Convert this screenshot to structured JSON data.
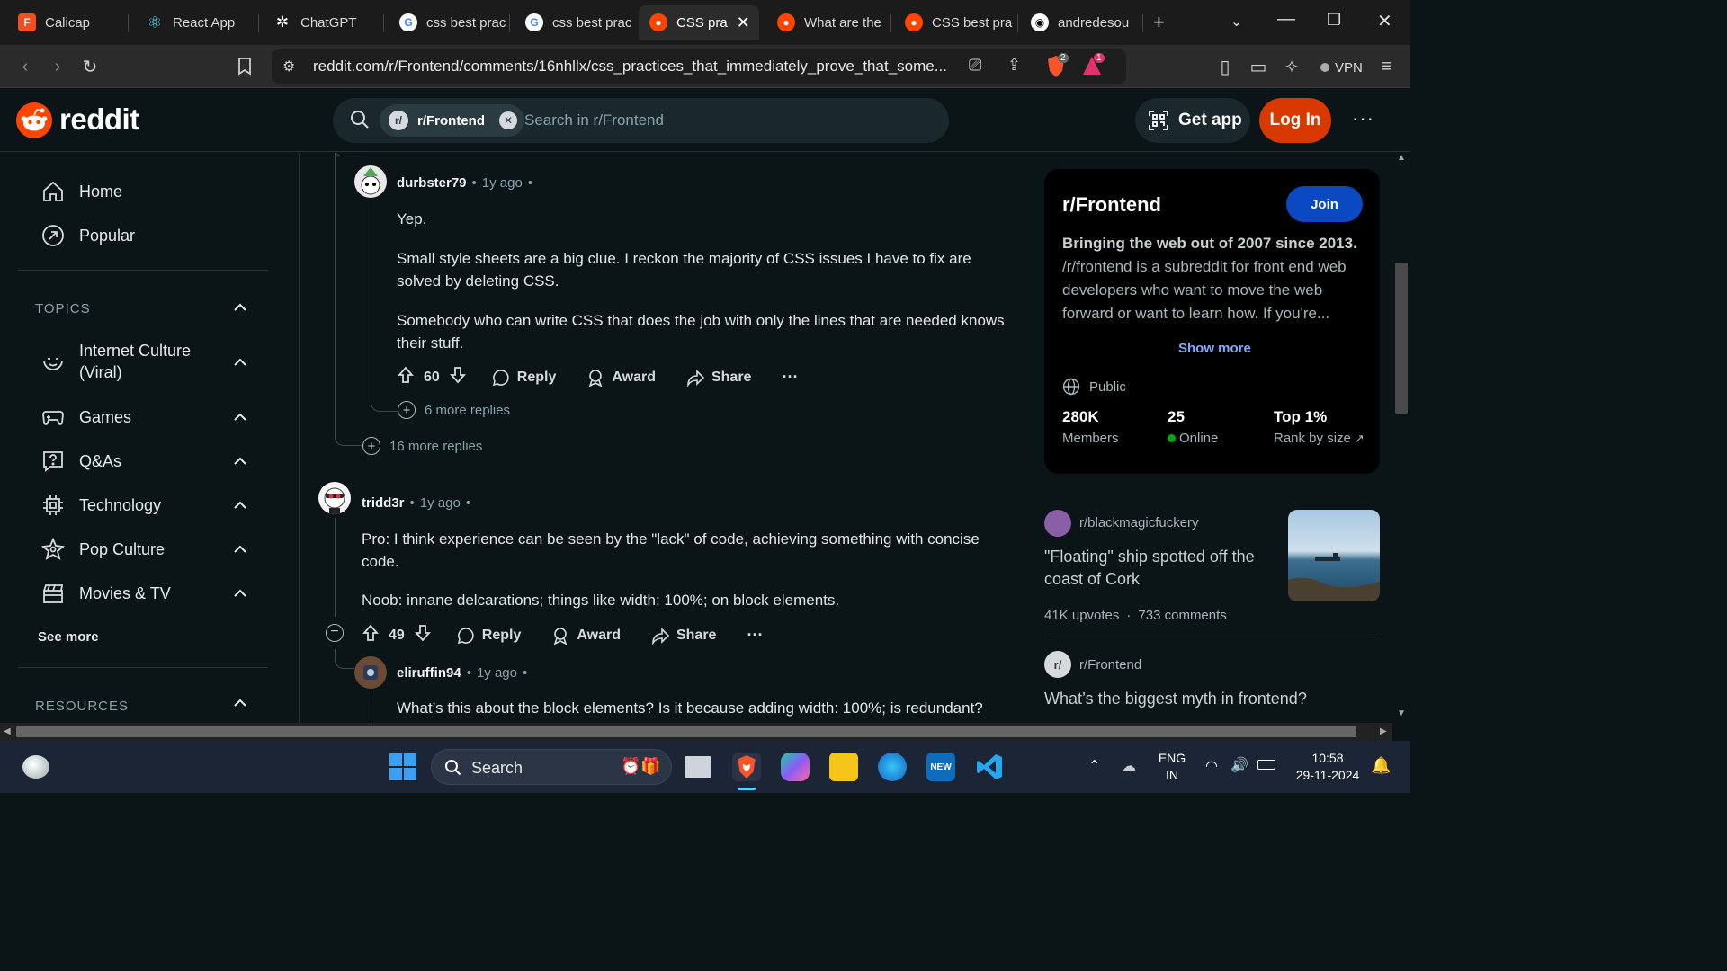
{
  "browser": {
    "tabs": [
      {
        "title": "Calicap",
        "icon": "figma-icon",
        "color": "#f24e1e"
      },
      {
        "title": "React App",
        "icon": "react-icon",
        "color": "#61dafb"
      },
      {
        "title": "ChatGPT",
        "icon": "chatgpt-icon",
        "color": "#ffffff"
      },
      {
        "title": "css best prac",
        "icon": "google-icon",
        "color": "#4285f4"
      },
      {
        "title": "css best prac",
        "icon": "google-icon",
        "color": "#4285f4"
      },
      {
        "title": "CSS pra",
        "icon": "reddit-icon",
        "color": "#ff4500",
        "active": true
      },
      {
        "title": "What are the",
        "icon": "reddit-icon",
        "color": "#ff4500"
      },
      {
        "title": "CSS best pra",
        "icon": "reddit-icon",
        "color": "#ff4500"
      },
      {
        "title": "andredesou",
        "icon": "github-icon",
        "color": "#ffffff"
      }
    ],
    "url": "reddit.com/r/Frontend/comments/16nhllx/css_practices_that_immediately_prove_that_some...",
    "brave_badge": "2",
    "rewards_badge": "1",
    "vpn_label": "VPN"
  },
  "header": {
    "logo": "reddit",
    "search_chip": "r/Frontend",
    "search_placeholder": "Search in r/Frontend",
    "get_app": "Get app",
    "login": "Log In"
  },
  "nav": {
    "home": "Home",
    "popular": "Popular",
    "topics_title": "TOPICS",
    "topics": [
      {
        "label": "Internet Culture (Viral)",
        "icon": "smile-icon"
      },
      {
        "label": "Games",
        "icon": "gamepad-icon"
      },
      {
        "label": "Q&As",
        "icon": "question-icon"
      },
      {
        "label": "Technology",
        "icon": "chip-icon"
      },
      {
        "label": "Pop Culture",
        "icon": "star-icon"
      },
      {
        "label": "Movies & TV",
        "icon": "clapper-icon"
      }
    ],
    "see_more": "See more",
    "resources_title": "RESOURCES"
  },
  "comments": [
    {
      "user": "durbster79",
      "time": "1y ago",
      "paragraphs": [
        "Yep.",
        "Small style sheets are a big clue. I reckon the majority of CSS issues I have to fix are solved by deleting CSS.",
        "Somebody who can write CSS that does the job with only the lines that are needed knows their stuff."
      ],
      "votes": "60",
      "more_replies": "6 more replies"
    },
    {
      "user": "tridd3r",
      "time": "1y ago",
      "paragraphs": [
        "Pro: I think experience can be seen by the \"lack\" of code, achieving something with concise code.",
        "Noob: innane delcarations; things like width: 100%; on block elements."
      ],
      "votes": "49"
    },
    {
      "user": "eliruffin94",
      "time": "1y ago",
      "paragraphs": [
        "What’s this about the block elements? Is it because adding width: 100%; is redundant?"
      ]
    }
  ],
  "outer_more_replies": "16 more replies",
  "actions": {
    "reply": "Reply",
    "award": "Award",
    "share": "Share",
    "more": "···"
  },
  "sidebar": {
    "sub_name": "r/Frontend",
    "join": "Join",
    "tagline": "Bringing the web out of 2007 since 2013.",
    "description": "/r/frontend is a subreddit for front end web developers who want to move the web forward or want to learn how. If you're...",
    "show_more": "Show more",
    "visibility": "Public",
    "members_val": "280K",
    "members_lbl": "Members",
    "online_val": "25",
    "online_lbl": "Online",
    "rank_val": "Top 1%",
    "rank_lbl": "Rank by size",
    "posts": [
      {
        "sub": "r/blackmagicfuckery",
        "title": "\"Floating\" ship spotted off the coast of Cork",
        "upvotes": "41K upvotes",
        "comments": "733 comments"
      },
      {
        "sub": "r/Frontend",
        "title": "What’s the biggest myth in frontend?"
      }
    ]
  },
  "taskbar": {
    "search": "Search",
    "lang": "ENG",
    "region": "IN",
    "time": "10:58",
    "date": "29-11-2024"
  },
  "colors": {
    "accent": "#d93900",
    "join": "#0a49c2",
    "online": "#01a816",
    "background": "#0b1416"
  }
}
